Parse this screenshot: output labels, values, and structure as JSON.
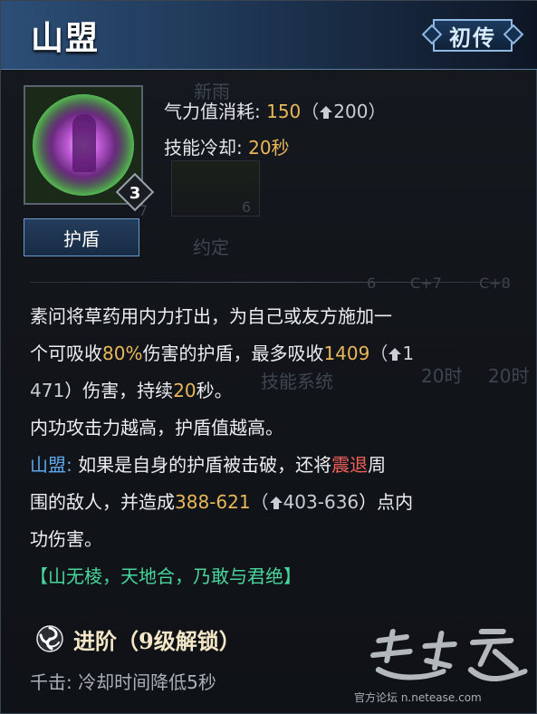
{
  "header": {
    "title": "山盟",
    "rank_badge": "初传"
  },
  "skill": {
    "icon": "skill-orb-icon",
    "level": "3",
    "category": "护盾"
  },
  "stats": {
    "cost_label": "气力值消耗:",
    "cost_value": "150",
    "cost_paren_open": "（",
    "cost_upgrade": "200",
    "cost_paren_close": "）",
    "cooldown_label": "技能冷却:",
    "cooldown_value": "20秒"
  },
  "background_ghost": {
    "label_top": "新雨",
    "label_card": "约定",
    "num_7": "7",
    "num_6a": "6",
    "num_6b": "6",
    "c7": "C+7",
    "c8": "C+8",
    "time1": "20时",
    "time2": "20时",
    "system": "技能系统"
  },
  "description": {
    "l1": "素问将草药用内力打出，为自己或友方施加一",
    "l2_a": "个可吸收",
    "l2_pct": "80%",
    "l2_b": "伤害的护盾，最多吸收",
    "l2_val": "1409",
    "l2_c": "（",
    "l2_up": "1",
    "l3_up": "471",
    "l3_a": "）伤害，持续",
    "l3_dur": "20",
    "l3_b": "秒。",
    "l4": "内功攻击力越高，护盾值越高。",
    "l5_name": "山盟:",
    "l5_a": " 如果是自身的护盾被击破，还将",
    "l5_knock": "震退",
    "l5_b": "周",
    "l6_a": "围的敌人，并造成",
    "l6_dmg": "388-621",
    "l6_b": "（",
    "l6_up": "403-636",
    "l6_c": "）点内",
    "l7": "功伤害。",
    "l8": "【山无棱，天地合，乃敢与君绝】"
  },
  "advance": {
    "icon": "swirl-icon",
    "title": "进阶（9级解锁）",
    "item": "千击: 冷却时间降低5秒"
  },
  "watermark": {
    "logo": "逆水寒",
    "text": "官方论坛 n.netease.com"
  },
  "colors": {
    "gold": "#e8b75a",
    "blue": "#5ea9ee",
    "red": "#f0605a",
    "green": "#49d69c"
  }
}
